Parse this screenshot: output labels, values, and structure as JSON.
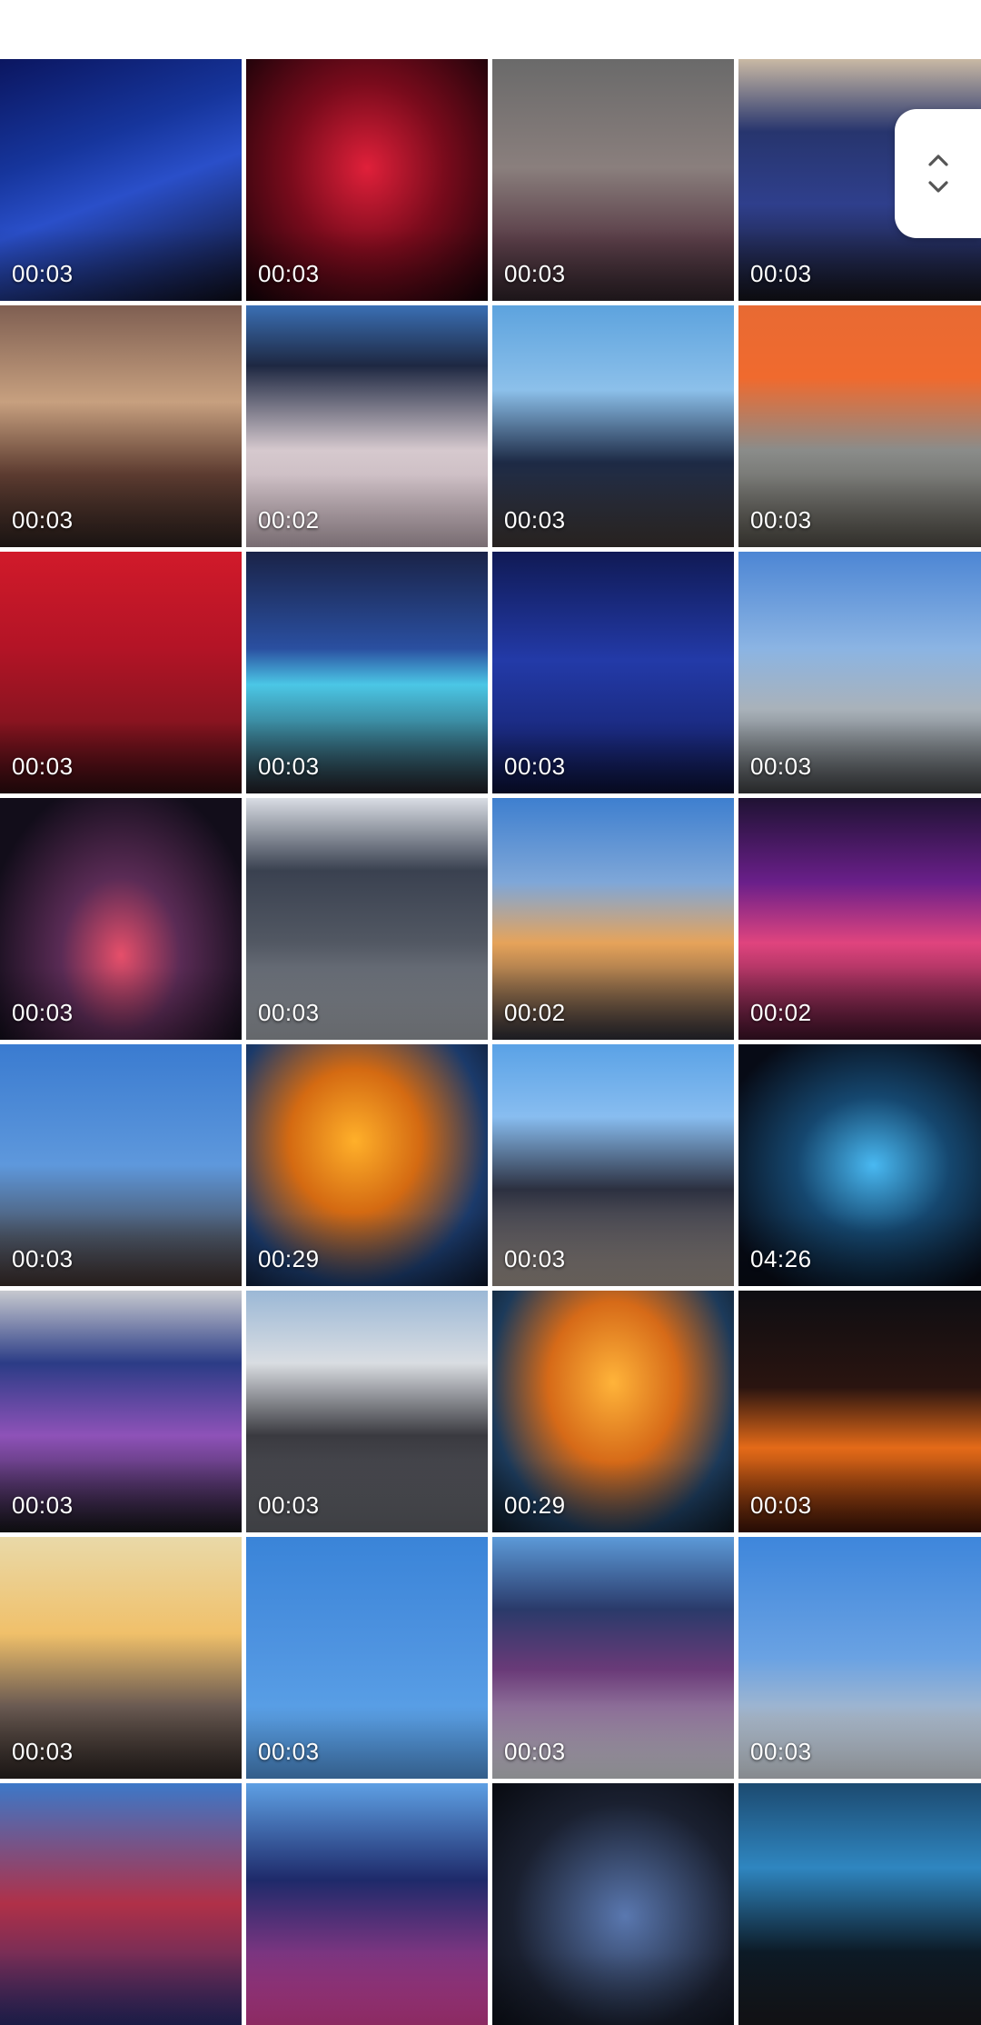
{
  "grid": {
    "items": [
      {
        "duration": "00:03",
        "bg": "linear-gradient(160deg,#0b1660 0%,#16359c 35%,#2a4fc9 55%,#0c0c18 100%)"
      },
      {
        "duration": "00:03",
        "bg": "radial-gradient(ellipse at 50% 45%,#e0203a 0%,#7a0b1c 45%,#120207 100%)"
      },
      {
        "duration": "00:03",
        "bg": "linear-gradient(180deg,#6a6a6a 0%,#8a7f7d 45%,#5a3e48 75%,#2c2127 100%)"
      },
      {
        "duration": "00:03",
        "bg": "linear-gradient(180deg,#c9b9a4 0%,#27356e 30%,#2f3f8c 60%,#121218 100%)"
      },
      {
        "duration": "00:03",
        "bg": "linear-gradient(180deg,#7f5f52 0%,#c7a07f 40%,#5c3b30 70%,#2a1f1c 100%)"
      },
      {
        "duration": "00:02",
        "bg": "linear-gradient(180deg,#3a6fb4 0%,#1e2842 25%,#d6c9ce 60%,#b8a6ae 100%)"
      },
      {
        "duration": "00:03",
        "bg": "linear-gradient(180deg,#5da3de 0%,#8cc0ea 35%,#1d2a45 65%,#3b3431 100%)"
      },
      {
        "duration": "00:03",
        "bg": "linear-gradient(180deg,#e86a33 0%,#f06a2e 30%,#8a8c8a 60%,#4d4a43 100%)"
      },
      {
        "duration": "00:03",
        "bg": "linear-gradient(180deg,#d11a2a 0%,#b31426 40%,#8a1420 70%,#2a0a0e 100%)"
      },
      {
        "duration": "00:03",
        "bg": "linear-gradient(180deg,#1a2348 0%,#2a4fa0 40%,#4bc7e6 55%,#1e1c22 100%)"
      },
      {
        "duration": "00:03",
        "bg": "linear-gradient(180deg,#101a55 0%,#233aa8 45%,#1a2a80 75%,#0a0f30 100%)"
      },
      {
        "duration": "00:03",
        "bg": "linear-gradient(180deg,#4d86d4 0%,#8bb4e3 40%,#a9b2ba 65%,#3b3d3f 100%)"
      },
      {
        "duration": "00:03",
        "bg": "radial-gradient(ellipse at 50% 65%,#e64f6a 0%,#5a2b55 35%,#120d1a 80%)"
      },
      {
        "duration": "00:03",
        "bg": "linear-gradient(180deg,#d9dde4 0%,#3a4150 30%,#525863 60%,#9a9ea4 100%)"
      },
      {
        "duration": "00:02",
        "bg": "linear-gradient(180deg,#3e7fcf 0%,#7fa7d8 35%,#e6a35a 60%,#2a2a33 100%)"
      },
      {
        "duration": "00:02",
        "bg": "linear-gradient(180deg,#1f1233 0%,#6a1f8a 35%,#e0447e 60%,#3a1126 100%)"
      },
      {
        "duration": "00:03",
        "bg": "linear-gradient(180deg,#3a7bd0 0%,#5e98dc 50%,#4a5363 80%,#3b2e2b 100%)"
      },
      {
        "duration": "00:29",
        "bg": "radial-gradient(ellipse at 45% 40%,#ffb02a 0%,#d46a12 35%,#1b3a6a 70%,#0c1426 100%)"
      },
      {
        "duration": "00:03",
        "bg": "linear-gradient(180deg,#5aa2e6 0%,#88bdf0 30%,#2c3040 60%,#9a8f86 100%)"
      },
      {
        "duration": "04:26",
        "bg": "radial-gradient(ellipse at 55% 50%,#49b9f2 0%,#15476f 40%,#070b16 85%)"
      },
      {
        "duration": "00:03",
        "bg": "linear-gradient(180deg,#c7c9cf 0%,#2b3c86 30%,#8e52b8 60%,#141418 100%)"
      },
      {
        "duration": "00:03",
        "bg": "linear-gradient(180deg,#9bb8d6 0%,#d9dde2 30%,#3a3a40 60%,#5e6066 100%)"
      },
      {
        "duration": "00:29",
        "bg": "radial-gradient(ellipse at 50% 38%,#ffb43a 0%,#d66a18 38%,#1c3a5a 72%,#0c1620 100%)"
      },
      {
        "duration": "00:03",
        "bg": "linear-gradient(180deg,#0e0e12 0%,#2a1410 40%,#e46a18 65%,#3a1206 100%)"
      },
      {
        "duration": "00:03",
        "bg": "linear-gradient(180deg,#e9d9a8 0%,#f0c06a 40%,#6a5a52 70%,#2a2320 100%)"
      },
      {
        "duration": "00:03",
        "bg": "linear-gradient(180deg,#3a84d8 0%,#4e93e0 45%,#5aa0e6 75%,#4f90d4 100%)"
      },
      {
        "duration": "00:03",
        "bg": "linear-gradient(180deg,#5c9ad8 0%,#2a3a6a 30%,#6a3a78 55%,#cfd2d6 100%)"
      },
      {
        "duration": "00:03",
        "bg": "linear-gradient(180deg,#3e86db 0%,#6aa2e3 50%,#a9b9cc 75%,#cdd3da 100%)"
      },
      {
        "duration": "",
        "bg": "linear-gradient(180deg,#3c78c8 0%,#b03048 50%,#2a2a6a 100%)"
      },
      {
        "duration": "",
        "bg": "linear-gradient(180deg,#5ea0e4 0%,#1e2a6a 40%,#d64096 100%)"
      },
      {
        "duration": "",
        "bg": "radial-gradient(ellipse at 55% 55%,#5a78b0 0%,#1a2030 60%,#080a10 100%)"
      },
      {
        "duration": "",
        "bg": "linear-gradient(180deg,#1c4a70 0%,#2f86c0 35%,#0c1a26 70%,#1a1a1e 100%)"
      }
    ]
  },
  "scroll_control": {
    "up_icon": "chevron-up-icon",
    "down_icon": "chevron-down-icon",
    "color": "#555555"
  }
}
